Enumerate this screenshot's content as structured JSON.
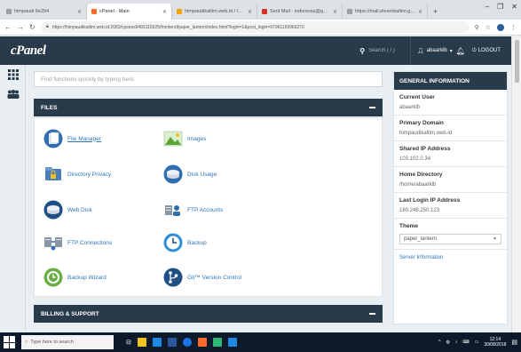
{
  "browser": {
    "tabs": [
      {
        "label": "himpaudi 6e294",
        "active": false,
        "color": "#9aa0a6"
      },
      {
        "label": "cPanel - Main",
        "active": true,
        "color": "#ff6c2c"
      },
      {
        "label": "himpaudikaltim.web.id / local",
        "active": false,
        "color": "#f0a30a"
      },
      {
        "label": "Sent Mail - indonesia@gmail",
        "active": false,
        "color": "#d93025"
      },
      {
        "label": "https://mail.elearnkaltim.go.id",
        "active": false,
        "color": "#9aa0a6"
      }
    ],
    "new_tab_glyph": "+",
    "window_controls": [
      "–",
      "❐",
      "✕"
    ],
    "url": "https://himpaudikaltim.web.id:2083/cpsess9493115925/frontend/paper_lantern/index.html?login=1&post_login=97961159966270"
  },
  "header": {
    "logo": "cPanel",
    "search_placeholder": "Search ( / )",
    "user": "abaarklb",
    "logout_label": "LOGOUT"
  },
  "find": {
    "placeholder": "Find functions quickly by typing here."
  },
  "files": {
    "title": "FILES",
    "tools": [
      {
        "label": "File Manager",
        "icon": "file-manager-icon"
      },
      {
        "label": "Images",
        "icon": "images-icon"
      },
      {
        "label": "Directory Privacy",
        "icon": "directory-privacy-icon"
      },
      {
        "label": "Disk Usage",
        "icon": "disk-usage-icon"
      },
      {
        "label": "Web Disk",
        "icon": "web-disk-icon"
      },
      {
        "label": "FTP Accounts",
        "icon": "ftp-accounts-icon"
      },
      {
        "label": "FTP Connections",
        "icon": "ftp-connections-icon"
      },
      {
        "label": "Backup",
        "icon": "backup-icon"
      },
      {
        "label": "Backup Wizard",
        "icon": "backup-wizard-icon"
      },
      {
        "label": "Git™ Version Control",
        "icon": "git-icon"
      }
    ]
  },
  "billing": {
    "title": "BILLING & SUPPORT"
  },
  "general_info": {
    "title": "GENERAL INFORMATION",
    "current_user_label": "Current User",
    "current_user": "abaarklb",
    "primary_domain_label": "Primary Domain",
    "primary_domain": "himpaudikaltim.web.id",
    "shared_ip_label": "Shared IP Address",
    "shared_ip": "103.102.0.34",
    "home_dir_label": "Home Directory",
    "home_dir": "/home/abaarklb",
    "last_login_label": "Last Login IP Address",
    "last_login": "180.248.250.123",
    "theme_label": "Theme",
    "theme": "paper_lantern",
    "server_info_link": "Server Information"
  },
  "taskbar": {
    "search_placeholder": "Type here to search",
    "time": "12:14",
    "date": "30/08/2018",
    "app_colors": [
      "#f0c419",
      "#1e88e5",
      "#2b579a",
      "#1a73e8",
      "#ff6c2c",
      "#2eb872",
      "#1e88e5"
    ]
  },
  "colors": {
    "header_bg": "#293a4a",
    "link": "#2f76b6"
  }
}
